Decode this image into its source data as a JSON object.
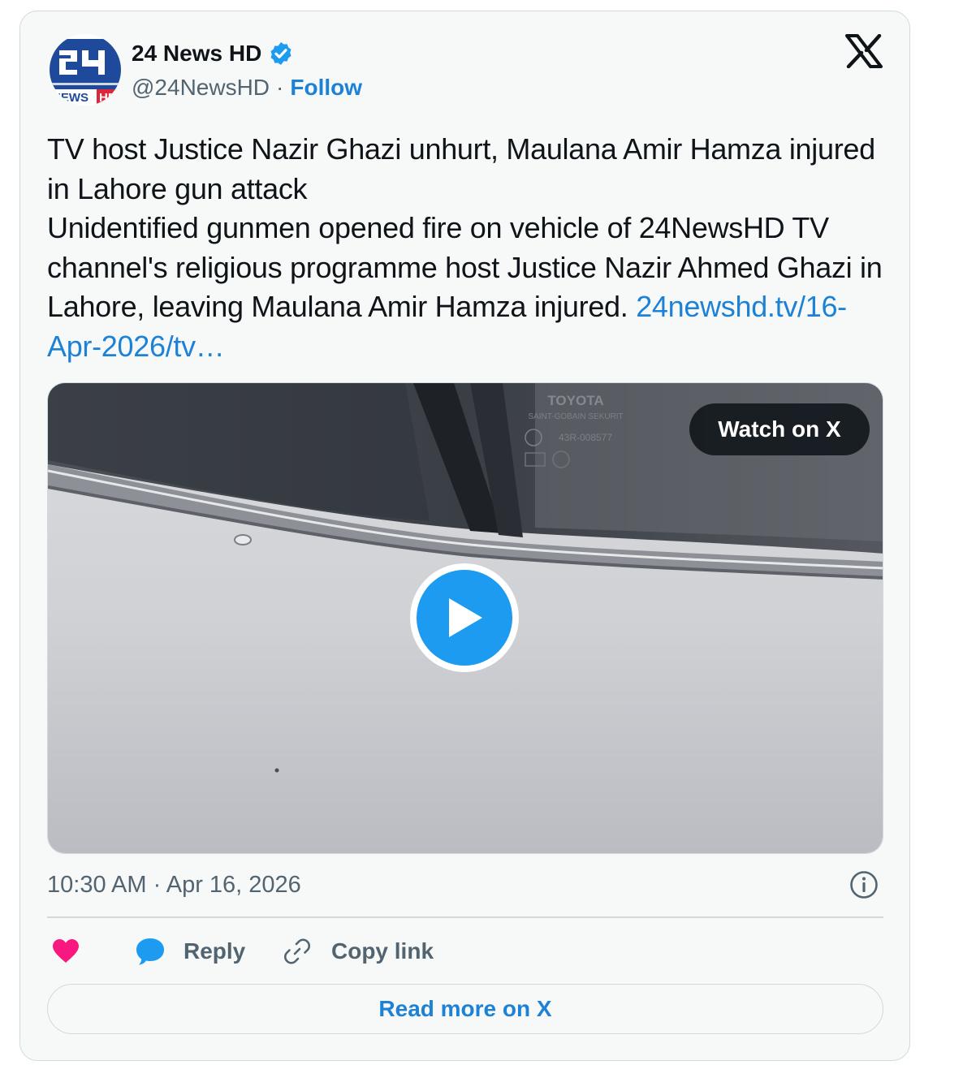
{
  "account": {
    "name": "24 News HD",
    "handle": "@24NewsHD",
    "separator": "·",
    "follow_label": "Follow",
    "avatar_text": "NEWS HD",
    "verified": true
  },
  "brand": {
    "icon": "x-logo-icon"
  },
  "tweet": {
    "line1": "TV host Justice Nazir Ghazi unhurt, Maulana Amir Hamza injured in Lahore gun attack",
    "line2": "Unidentified gunmen opened fire on vehicle of 24NewsHD TV channel's religious programme host Justice Nazir Ahmed Ghazi in Lahore, leaving Maulana Amir Hamza injured.",
    "link_text": "24newshd.tv/16-Apr-2026/tv…"
  },
  "media": {
    "watch_label": "Watch on X",
    "window_text": {
      "brand": "TOYOTA",
      "maker": "SAINT-GOBAIN SEKURIT",
      "code": "43R-008577"
    }
  },
  "meta": {
    "time": "10:30 AM",
    "separator": "·",
    "date": "Apr 16, 2026"
  },
  "actions": {
    "like_icon": "heart-icon",
    "reply_label": "Reply",
    "copy_label": "Copy link"
  },
  "read_more_label": "Read more on X",
  "colors": {
    "accent": "#1d9bf0",
    "link": "#1d82d6",
    "heart": "#f91880",
    "card_bg": "#f7f9f9",
    "border": "#cfd9de",
    "text": "#0f1419",
    "muted": "#536471"
  }
}
